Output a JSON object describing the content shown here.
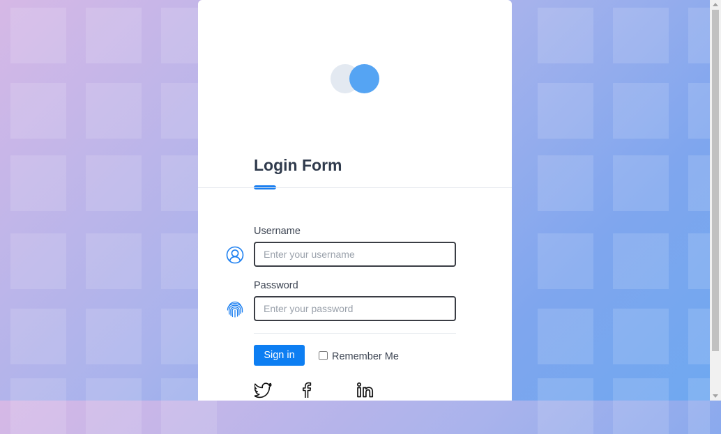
{
  "logo": {
    "icon": "two-circles-logo-icon",
    "colors": [
      "#e3e9f1",
      "#55a4f3"
    ]
  },
  "form": {
    "title": "Login Form",
    "accent": "#1a7ef0",
    "username": {
      "label": "Username",
      "placeholder": "Enter your username",
      "icon": "user-icon"
    },
    "password": {
      "label": "Password",
      "placeholder": "Enter your password",
      "icon": "fingerprint-icon"
    },
    "submit_label": "Sign in",
    "remember_label": "Remember Me",
    "remember_checked": false
  },
  "social": [
    "twitter-icon",
    "facebook-icon",
    "linkedin-icon"
  ],
  "colors": {
    "button": "#0d7ef2",
    "title": "#2f3a4c"
  }
}
